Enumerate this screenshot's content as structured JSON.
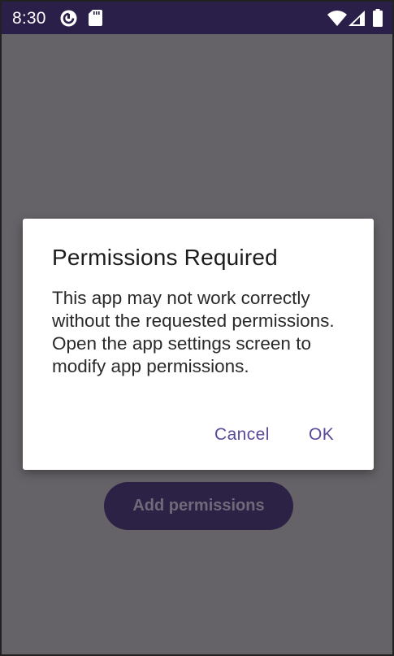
{
  "status_bar": {
    "time": "8:30",
    "icons": [
      "pocket-casts-icon",
      "sd-card-icon",
      "wifi-icon",
      "cellular-signal-icon",
      "battery-icon"
    ]
  },
  "main": {
    "add_permissions_label": "Add permissions"
  },
  "dialog": {
    "title": "Permissions Required",
    "message": "This app may not work correctly without the requested permissions. Open the app settings screen to modify app permissions.",
    "cancel_label": "Cancel",
    "ok_label": "OK"
  },
  "colors": {
    "status_bar": "#2a1f48",
    "scrim": "#656367",
    "accent": "#5b4a9c",
    "button_bg": "#2c2246"
  }
}
